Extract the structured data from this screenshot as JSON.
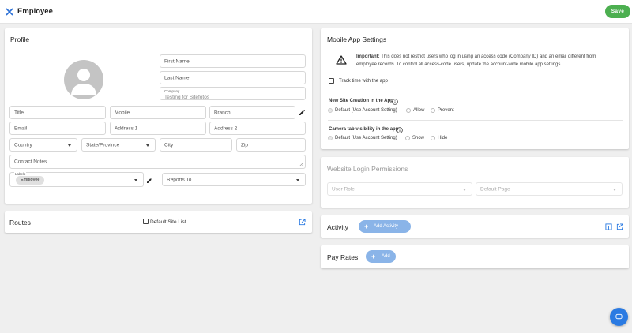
{
  "header": {
    "title": "Employee",
    "save_label": "Save",
    "icons": {
      "close": "close-icon"
    }
  },
  "profile": {
    "title": "Profile",
    "first_name": {
      "placeholder": "First Name"
    },
    "last_name": {
      "placeholder": "Last Name"
    },
    "company": {
      "label": "Company",
      "value": "Testing for Sitefotos"
    },
    "title_field": {
      "placeholder": "Title"
    },
    "mobile": {
      "placeholder": "Mobile"
    },
    "branch": {
      "placeholder": "Branch"
    },
    "email": {
      "placeholder": "Email"
    },
    "address1": {
      "placeholder": "Address 1"
    },
    "address2": {
      "placeholder": "Address 2"
    },
    "country": {
      "placeholder": "Country"
    },
    "state": {
      "placeholder": "State/Province"
    },
    "city": {
      "placeholder": "City"
    },
    "zip": {
      "placeholder": "Zip"
    },
    "contact_notes": {
      "placeholder": "Contact Notes"
    },
    "labels": {
      "label": "Labels",
      "chip": "Employee"
    },
    "reports_to": {
      "placeholder": "Reports To"
    }
  },
  "routes": {
    "title": "Routes",
    "default_site_list": "Default Site List"
  },
  "mobile_app": {
    "title": "Mobile App Settings",
    "important_label": "Important:",
    "important_line1": "This does not restrict users who log in using an access code (Company ID) and an email different from",
    "important_line2": "employee records. To control all access-code users, update the account-wide mobile app settings.",
    "track_time": "Track time with the app",
    "new_site_title": "New Site Creation in the App",
    "new_site_options": [
      "Default (Use Account Setting)",
      "Allow",
      "Prevent"
    ],
    "camera_title": "Camera tab visibility in the app",
    "camera_options": [
      "Default (Use Account Setting)",
      "Show",
      "Hide"
    ]
  },
  "website_login": {
    "title": "Website Login Permissions",
    "user_role": "User Role",
    "default_page": "Default Page"
  },
  "activity": {
    "title": "Activity",
    "add_label": "Add Activity"
  },
  "pay_rates": {
    "title": "Pay Rates",
    "add_label": "Add"
  },
  "colors": {
    "save": "#4caf50",
    "pill": "#8ab4e8",
    "link_icon": "#2a7ae2",
    "fab": "#2a7ae2"
  }
}
